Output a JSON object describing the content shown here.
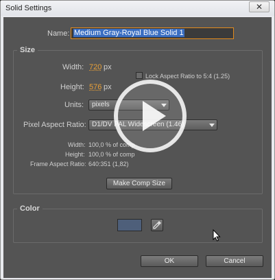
{
  "window": {
    "title": "Solid Settings",
    "close_glyph": "✕"
  },
  "name": {
    "label": "Name:",
    "value": "Medium Gray-Royal Blue Solid 1"
  },
  "size": {
    "section_title": "Size",
    "width_label": "Width:",
    "width_value": "720",
    "height_label": "Height:",
    "height_value": "576",
    "unit_px": "px",
    "lock_label": "Lock Aspect Ratio to 5:4 (1.25)",
    "units_label": "Units:",
    "units_value": "pixels",
    "par_label": "Pixel Aspect Ratio:",
    "par_value": "D1/DV PAL Widescreen (1.46)",
    "info": [
      {
        "label": "Width:",
        "value": "100,0 % of comp"
      },
      {
        "label": "Height:",
        "value": "100,0 % of comp"
      },
      {
        "label": "Frame Aspect Ratio:",
        "value": "640:351 (1,82)"
      }
    ],
    "make_comp_size": "Make Comp Size"
  },
  "color": {
    "section_title": "Color",
    "swatch_color": "#4e5f7a"
  },
  "footer": {
    "ok_label": "OK",
    "cancel_label": "Cancel"
  },
  "overlay": {
    "icon": "play-icon"
  },
  "colors": {
    "panel": "#545454",
    "accent_orange": "#e8a038",
    "selection": "#3a6ec2"
  }
}
